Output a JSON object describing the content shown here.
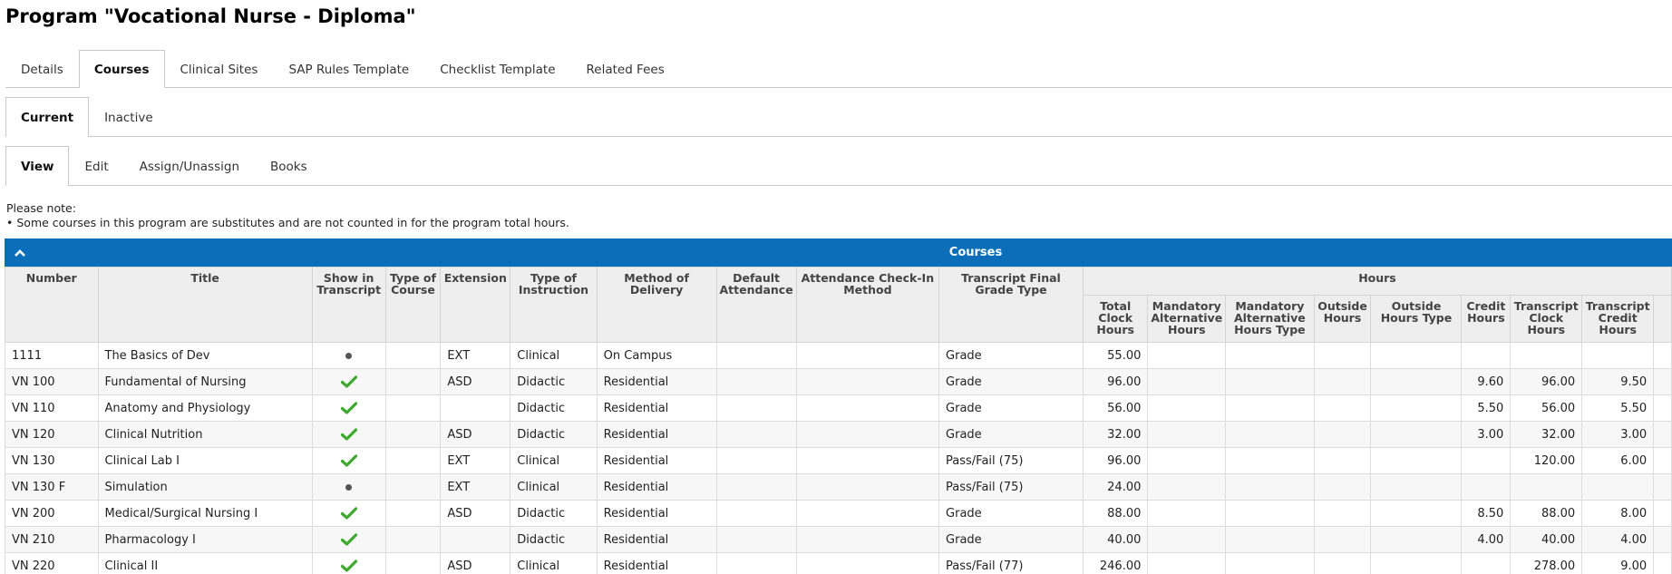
{
  "page": {
    "title": "Program \"Vocational Nurse - Diploma\""
  },
  "top_tabs": [
    "Details",
    "Courses",
    "Clinical Sites",
    "SAP Rules Template",
    "Checklist Template",
    "Related Fees"
  ],
  "status_tabs": [
    "Current",
    "Inactive"
  ],
  "action_tabs": [
    "View",
    "Edit",
    "Assign/Unassign",
    "Books"
  ],
  "note": {
    "heading": "Please note:",
    "text": "Some courses in this program are substitutes and are not counted in for the program total hours."
  },
  "grid": {
    "title": "Courses",
    "group_header": "Hours",
    "columns": {
      "number": "Number",
      "title": "Title",
      "show_in_transcript": "Show in Transcript",
      "type_of_course": "Type of Course",
      "extension": "Extension",
      "type_of_instruction": "Type of Instruction",
      "method_of_delivery": "Method of Delivery",
      "default_attendance": "Default Attendance",
      "attendance_check_in": "Attendance Check-In Method",
      "final_grade_type": "Transcript Final Grade Type",
      "total_clock_hours": "Total Clock Hours",
      "mandatory_alt_hours": "Mandatory Alternative Hours",
      "mandatory_alt_hours_type": "Mandatory Alternative Hours Type",
      "outside_hours": "Outside Hours",
      "outside_hours_type": "Outside Hours Type",
      "credit_hours": "Credit Hours",
      "transcript_clock_hours": "Transcript Clock Hours",
      "transcript_credit_hours": "Transcript Credit Hours"
    },
    "rows": [
      {
        "number": "1111",
        "title": "The Basics of Dev",
        "transcript": "dot",
        "type_of_course": "",
        "extension": "EXT",
        "instruction": "Clinical",
        "delivery": "On Campus",
        "default_attendance": "",
        "check_in": "",
        "grade_type": "Grade",
        "total_clock": "55.00",
        "mand_alt": "",
        "mand_alt_type": "",
        "outside": "",
        "outside_type": "",
        "credit": "",
        "tr_clock": "",
        "tr_credit": ""
      },
      {
        "number": "VN 100",
        "title": "Fundamental of Nursing",
        "transcript": "check",
        "type_of_course": "",
        "extension": "ASD",
        "instruction": "Didactic",
        "delivery": "Residential",
        "default_attendance": "",
        "check_in": "",
        "grade_type": "Grade",
        "total_clock": "96.00",
        "mand_alt": "",
        "mand_alt_type": "",
        "outside": "",
        "outside_type": "",
        "credit": "9.60",
        "tr_clock": "96.00",
        "tr_credit": "9.50"
      },
      {
        "number": "VN 110",
        "title": "Anatomy and Physiology",
        "transcript": "check",
        "type_of_course": "",
        "extension": "",
        "instruction": "Didactic",
        "delivery": "Residential",
        "default_attendance": "",
        "check_in": "",
        "grade_type": "Grade",
        "total_clock": "56.00",
        "mand_alt": "",
        "mand_alt_type": "",
        "outside": "",
        "outside_type": "",
        "credit": "5.50",
        "tr_clock": "56.00",
        "tr_credit": "5.50"
      },
      {
        "number": "VN 120",
        "title": "Clinical Nutrition",
        "transcript": "check",
        "type_of_course": "",
        "extension": "ASD",
        "instruction": "Didactic",
        "delivery": "Residential",
        "default_attendance": "",
        "check_in": "",
        "grade_type": "Grade",
        "total_clock": "32.00",
        "mand_alt": "",
        "mand_alt_type": "",
        "outside": "",
        "outside_type": "",
        "credit": "3.00",
        "tr_clock": "32.00",
        "tr_credit": "3.00"
      },
      {
        "number": "VN 130",
        "title": "Clinical Lab I",
        "transcript": "check",
        "type_of_course": "",
        "extension": "EXT",
        "instruction": "Clinical",
        "delivery": "Residential",
        "default_attendance": "",
        "check_in": "",
        "grade_type": "Pass/Fail (75)",
        "total_clock": "96.00",
        "mand_alt": "",
        "mand_alt_type": "",
        "outside": "",
        "outside_type": "",
        "credit": "",
        "tr_clock": "120.00",
        "tr_credit": "6.00"
      },
      {
        "number": "VN 130 F",
        "title": "Simulation",
        "transcript": "dot",
        "type_of_course": "",
        "extension": "EXT",
        "instruction": "Clinical",
        "delivery": "Residential",
        "default_attendance": "",
        "check_in": "",
        "grade_type": "Pass/Fail (75)",
        "total_clock": "24.00",
        "mand_alt": "",
        "mand_alt_type": "",
        "outside": "",
        "outside_type": "",
        "credit": "",
        "tr_clock": "",
        "tr_credit": ""
      },
      {
        "number": "VN 200",
        "title": "Medical/Surgical Nursing I",
        "transcript": "check",
        "type_of_course": "",
        "extension": "ASD",
        "instruction": "Didactic",
        "delivery": "Residential",
        "default_attendance": "",
        "check_in": "",
        "grade_type": "Grade",
        "total_clock": "88.00",
        "mand_alt": "",
        "mand_alt_type": "",
        "outside": "",
        "outside_type": "",
        "credit": "8.50",
        "tr_clock": "88.00",
        "tr_credit": "8.00"
      },
      {
        "number": "VN 210",
        "title": "Pharmacology I",
        "transcript": "check",
        "type_of_course": "",
        "extension": "",
        "instruction": "Didactic",
        "delivery": "Residential",
        "default_attendance": "",
        "check_in": "",
        "grade_type": "Grade",
        "total_clock": "40.00",
        "mand_alt": "",
        "mand_alt_type": "",
        "outside": "",
        "outside_type": "",
        "credit": "4.00",
        "tr_clock": "40.00",
        "tr_credit": "4.00"
      },
      {
        "number": "VN 220",
        "title": "Clinical II",
        "transcript": "check",
        "type_of_course": "",
        "extension": "ASD",
        "instruction": "Clinical",
        "delivery": "Residential",
        "default_attendance": "",
        "check_in": "",
        "grade_type": "Pass/Fail (77)",
        "total_clock": "246.00",
        "mand_alt": "",
        "mand_alt_type": "",
        "outside": "",
        "outside_type": "",
        "credit": "",
        "tr_clock": "278.00",
        "tr_credit": "9.00"
      }
    ]
  },
  "colors": {
    "accent": "#0b6eb8",
    "check": "#3ea82f",
    "header_bg": "#eeeeee"
  }
}
